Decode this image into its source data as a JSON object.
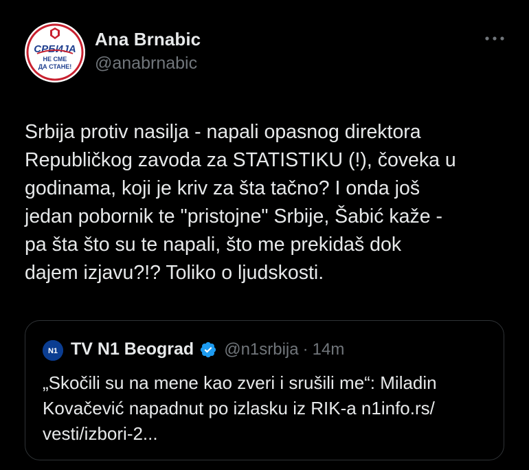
{
  "author": {
    "display_name": "Ana Brnabic",
    "handle": "@anabrnabic",
    "avatar_text": [
      "СРБИЈА",
      "НЕ СМЕ",
      "ДА СТАНЕ!"
    ]
  },
  "tweet": {
    "text": "Srbija protiv nasilja - napali opasnog direktora\nRepubličkog zavoda za STATISTIKU (!), čoveka u\ngodinama, koji je kriv za šta tačno? I onda još\njedan pobornik te \"pristojne\" Srbije, Šabić kaže -\npa šta što su te napali, što me prekidaš dok\ndajem izjavu?!? Toliko o ljudskosti."
  },
  "quoted_tweet": {
    "logo_text": "N1",
    "display_name": "TV N1 Beograd",
    "verified": true,
    "handle": "@n1srbija",
    "separator": "·",
    "time": "14m",
    "text": "„Skočili su na mene kao zveri i srušili me“: Miladin\nKovačević napadnut po izlasku iz RIK-a n1info.rs/\nvesti/izbori-2..."
  },
  "colors": {
    "background": "#000000",
    "text_primary": "#e7e9ea",
    "text_secondary": "#71767b",
    "border": "#2f3336",
    "verified_blue": "#1d9bf0",
    "avatar_red": "#c8202f",
    "avatar_blue": "#1f3f8f",
    "n1_blue": "#0b3d91"
  },
  "icons": {
    "more": "more-horizontal-icon",
    "verified": "verified-badge-icon"
  }
}
